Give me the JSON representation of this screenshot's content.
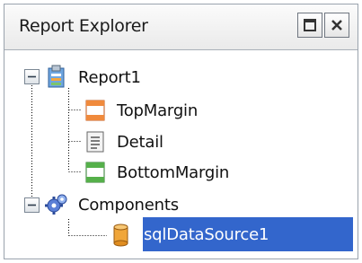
{
  "panel": {
    "title": "Report Explorer",
    "controls": [
      "window-icon",
      "close-icon"
    ]
  },
  "tree": {
    "report": {
      "label": "Report1",
      "expanded": true,
      "children": [
        {
          "label": "TopMargin",
          "icon": "top-margin-band-icon"
        },
        {
          "label": "Detail",
          "icon": "detail-band-icon"
        },
        {
          "label": "BottomMargin",
          "icon": "bottom-margin-band-icon"
        }
      ]
    },
    "components": {
      "label": "Components",
      "expanded": true,
      "children": [
        {
          "label": "sqlDataSource1",
          "icon": "database-icon",
          "selected": true
        }
      ]
    }
  },
  "colors": {
    "selection": "#3366cc",
    "selection_text": "#ffffff",
    "tree_lines": "#000000"
  }
}
